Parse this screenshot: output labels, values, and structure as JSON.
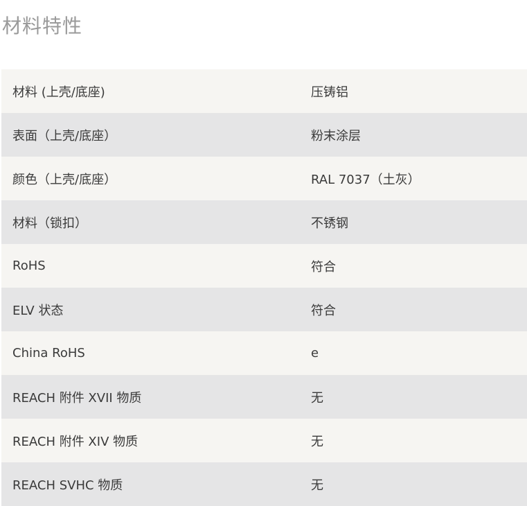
{
  "section": {
    "title": "材料特性"
  },
  "rows": [
    {
      "label": "材料 (上壳/底座)",
      "value": "压铸铝"
    },
    {
      "label": "表面（上壳/底座）",
      "value": "粉末涂层"
    },
    {
      "label": "颜色（上壳/底座）",
      "value": "RAL 7037（土灰）"
    },
    {
      "label": "材料（锁扣）",
      "value": "不锈钢"
    },
    {
      "label": "RoHS",
      "value": "符合"
    },
    {
      "label": "ELV 状态",
      "value": "符合"
    },
    {
      "label": "China RoHS",
      "value": "e"
    },
    {
      "label": "REACH 附件 XVII 物质",
      "value": "无"
    },
    {
      "label": "REACH 附件 XIV 物质",
      "value": "无"
    },
    {
      "label": "REACH SVHC 物质",
      "value": "无"
    }
  ]
}
